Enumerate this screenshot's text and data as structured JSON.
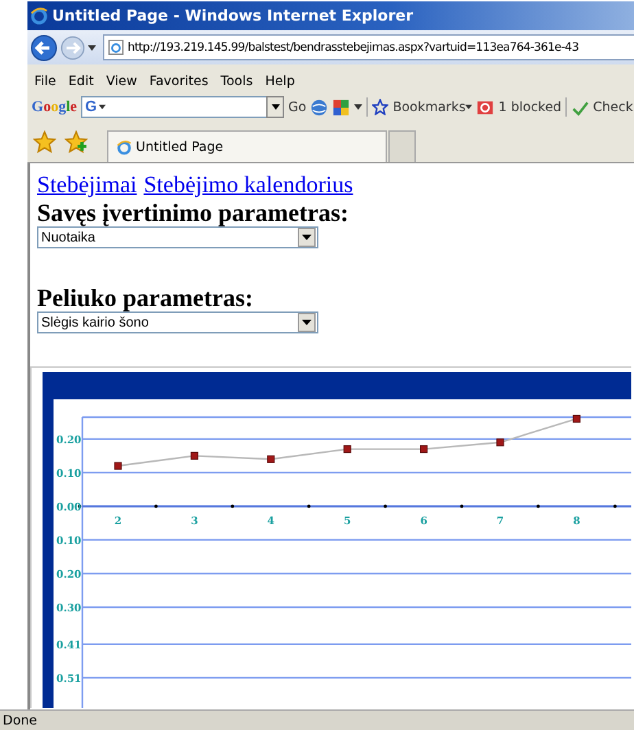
{
  "window": {
    "title": "Untitled Page - Windows Internet Explorer"
  },
  "address_bar": {
    "url": "http://193.219.145.99/balstest/bendrasstebejimas.aspx?vartuid=113ea764-361e-43"
  },
  "menu": [
    "File",
    "Edit",
    "View",
    "Favorites",
    "Tools",
    "Help"
  ],
  "google_toolbar": {
    "logo": "Google",
    "field_prefix": "G",
    "go": "Go",
    "bookmarks": "Bookmarks",
    "blocked": "1 blocked",
    "check": "Check"
  },
  "tabs": [
    {
      "label": "Untitled Page",
      "selected": true
    }
  ],
  "page": {
    "links": [
      "Stebėjimai",
      "Stebėjimo kalendorius"
    ],
    "sections": [
      {
        "heading": "Savęs įvertinimo parametras:",
        "value": "Nuotaika"
      },
      {
        "heading": "Peliuko parametras:",
        "value": "Slėgis kairio šono"
      }
    ],
    "chart_data": {
      "type": "line",
      "categories": [
        "2",
        "3",
        "4",
        "5",
        "6",
        "7",
        "8"
      ],
      "series": [
        {
          "color": "#b8b8b8",
          "marker": "s",
          "values": [
            0.12,
            0.15,
            0.14,
            0.17,
            0.17,
            0.19,
            0.26
          ]
        }
      ],
      "ylim": [
        -0.6,
        0.265
      ],
      "grid": true,
      "yticks": [
        {
          "value": 0.2,
          "label": "0.20"
        },
        {
          "value": 0.1,
          "label": "0.10"
        },
        {
          "value": 0,
          "label": "0.00"
        },
        {
          "value": -0.1,
          "label": "0.10"
        },
        {
          "value": -0.2,
          "label": "0.20"
        },
        {
          "value": -0.3,
          "label": "0.30"
        },
        {
          "value": -0.41,
          "label": "0.41"
        },
        {
          "value": -0.51,
          "label": "0.51"
        }
      ]
    }
  },
  "status_bar": {
    "text": "Done"
  }
}
